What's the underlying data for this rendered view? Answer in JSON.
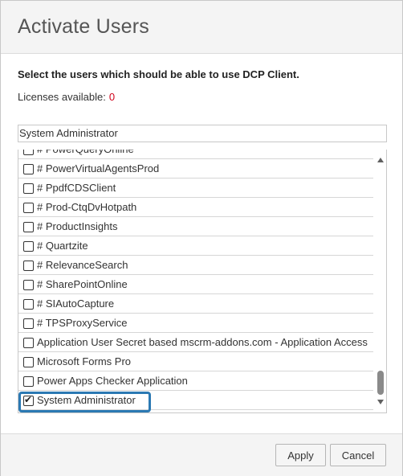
{
  "dialog": {
    "title": "Activate Users",
    "instructions": "Select the users which should be able to use DCP Client.",
    "licenses_label": "Licenses available:",
    "licenses_count": "0",
    "selected_value": "System Administrator"
  },
  "users": [
    {
      "label": "# PowerQueryOnline",
      "checked": false
    },
    {
      "label": "# PowerVirtualAgentsProd",
      "checked": false
    },
    {
      "label": "# PpdfCDSClient",
      "checked": false
    },
    {
      "label": "# Prod-CtqDvHotpath",
      "checked": false
    },
    {
      "label": "# ProductInsights",
      "checked": false
    },
    {
      "label": "# Quartzite",
      "checked": false
    },
    {
      "label": "# RelevanceSearch",
      "checked": false
    },
    {
      "label": "# SharePointOnline",
      "checked": false
    },
    {
      "label": "# SIAutoCapture",
      "checked": false
    },
    {
      "label": "# TPSProxyService",
      "checked": false
    },
    {
      "label": "Application User Secret based mscrm-addons.com - Application Access",
      "checked": false
    },
    {
      "label": "Microsoft Forms Pro",
      "checked": false
    },
    {
      "label": "Power Apps Checker Application",
      "checked": false
    },
    {
      "label": "System Administrator",
      "checked": true
    }
  ],
  "buttons": {
    "apply": "Apply",
    "cancel": "Cancel"
  },
  "colors": {
    "highlight": "#2b79b3",
    "count": "#d0021b"
  },
  "icons": {
    "scroll_up": "chevron-up-icon",
    "scroll_down": "chevron-down-icon",
    "checkbox": "checkbox-icon"
  }
}
